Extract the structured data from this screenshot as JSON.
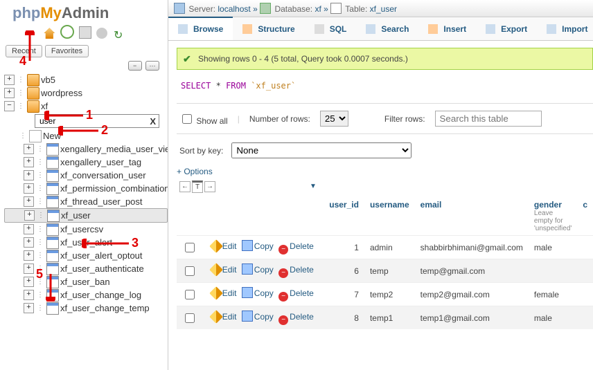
{
  "logo": {
    "php": "php",
    "my": "My",
    "admin": "Admin"
  },
  "nav": {
    "recent": "Recent",
    "favorites": "Favorites"
  },
  "breadcrumb": {
    "server_lbl": "Server:",
    "server": "localhost",
    "db_lbl": "Database:",
    "db": "xf",
    "tbl_lbl": "Table:",
    "tbl": "xf_user"
  },
  "tabs": {
    "browse": "Browse",
    "structure": "Structure",
    "sql": "SQL",
    "search": "Search",
    "insert": "Insert",
    "export": "Export",
    "import": "Import"
  },
  "success_msg": "Showing rows 0 - 4 (5 total, Query took 0.0007 seconds.)",
  "sql": {
    "select": "SELECT",
    "star": "*",
    "from": "FROM",
    "table": "`xf_user`"
  },
  "rowbar": {
    "show_all": "Show all",
    "num_rows": "Number of rows:",
    "rows_val": "25",
    "filter": "Filter rows:",
    "filter_ph": "Search this table"
  },
  "sortbar": {
    "label": "Sort by key:",
    "value": "None"
  },
  "options": "+ Options",
  "cols": {
    "user_id": "user_id",
    "username": "username",
    "email": "email",
    "gender": "gender",
    "gender_sub": "Leave empty for 'unspecified'",
    "c": "c"
  },
  "actions": {
    "edit": "Edit",
    "copy": "Copy",
    "delete": "Delete"
  },
  "rows": [
    {
      "user_id": "1",
      "username": "admin",
      "email": "shabbirbhimani@gmail.com",
      "gender": "male"
    },
    {
      "user_id": "6",
      "username": "temp",
      "email": "temp@gmail.com",
      "gender": ""
    },
    {
      "user_id": "7",
      "username": "temp2",
      "email": "temp2@gmail.com",
      "gender": "female"
    },
    {
      "user_id": "8",
      "username": "temp1",
      "email": "temp1@gmail.com",
      "gender": "male"
    }
  ],
  "tree": {
    "dbs": [
      {
        "name": "vb5",
        "open": false
      },
      {
        "name": "wordpress",
        "open": false
      }
    ],
    "open_db": "xf",
    "filter": "user",
    "new": "New",
    "tables": [
      "xengallery_media_user_view",
      "xengallery_user_tag",
      "xf_conversation_user",
      "xf_permission_combination_u",
      "xf_thread_user_post",
      "xf_user",
      "xf_usercsv",
      "xf_user_alert",
      "xf_user_alert_optout",
      "xf_user_authenticate",
      "xf_user_ban",
      "xf_user_change_log",
      "xf_user_change_temp"
    ],
    "selected_table": "xf_user"
  },
  "annotations": {
    "1": "1",
    "2": "2",
    "3": "3",
    "4": "4",
    "5": "5"
  }
}
